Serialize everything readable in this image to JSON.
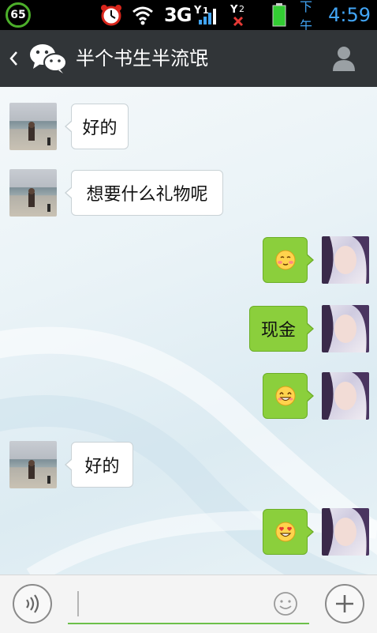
{
  "status_bar": {
    "battery_circle_value": "65",
    "network_type": "3G",
    "sim1_label": "1",
    "sim2_label": "2",
    "ampm": "下午",
    "time": "4:59",
    "battery_color": "#33cc33",
    "clock_color": "#42a5f5"
  },
  "header": {
    "back_icon": "chevron-left-icon",
    "app_icon": "wechat-icon",
    "title": "半个书生半流氓",
    "profile_icon": "person-icon"
  },
  "messages": [
    {
      "side": "in",
      "text": "好的"
    },
    {
      "side": "in",
      "text": "想要什么礼物呢"
    },
    {
      "side": "out",
      "text": "",
      "emoji": "blush-emoji"
    },
    {
      "side": "out",
      "text": "现金"
    },
    {
      "side": "out",
      "text": "",
      "emoji": "grin-emoji"
    },
    {
      "side": "in",
      "text": "好的"
    },
    {
      "side": "out",
      "text": "",
      "emoji": "heart-eyes-emoji"
    }
  ],
  "input_bar": {
    "voice_icon": "voice-icon",
    "input_value": "",
    "input_placeholder": "",
    "emoji_icon": "smiley-icon",
    "plus_icon": "plus-icon"
  },
  "colors": {
    "header_bg": "#313538",
    "outgoing_bubble": "#8bcf3c",
    "incoming_bubble": "#ffffff",
    "input_underline": "#6cc04a"
  }
}
